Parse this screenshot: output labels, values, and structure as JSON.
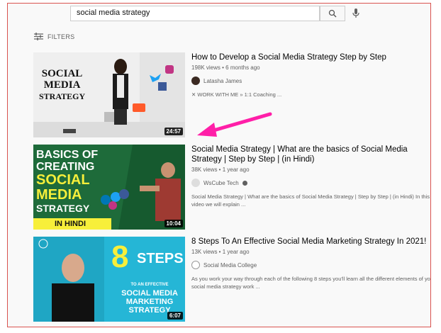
{
  "search": {
    "query": "social media strategy"
  },
  "filters_label": "FILTERS",
  "results": [
    {
      "thumb_lines": [
        "SOCIAL",
        "MEDIA",
        "STRATEGY"
      ],
      "duration": "24:57",
      "title": "How to Develop a Social Media Strategy Step by Step",
      "meta": "198K views • 6 months ago",
      "channel": "Latasha James",
      "desc": "✕ WORK WITH ME » 1:1 Coaching ..."
    },
    {
      "thumb_lines": [
        "BASICS OF",
        "CREATING",
        "SOCIAL",
        "MEDIA",
        "STRATEGY",
        "IN HINDI"
      ],
      "duration": "10:04",
      "title": "Social Media Strategy | What are the basics of Social Media Strategy | Step by Step | (in Hindi)",
      "meta": "38K views • 1 year ago",
      "channel": "WsCube Tech",
      "desc": "Social Media Strategy | What are the basics of Social Media Strategy | Step by Step | (in Hindi) In this video we will explain ..."
    },
    {
      "thumb_lines": [
        "8",
        "STEPS",
        "TO AN EFFECTIVE",
        "SOCIAL MEDIA",
        "MARKETING",
        "STRATEGY"
      ],
      "duration": "6:07",
      "title": "8 Steps To An Effective Social Media Marketing Strategy In 2021!",
      "meta": "13K views • 1 year ago",
      "channel": "Social Media College",
      "desc": "As you work your way through each of the following 8 steps you'll learn all the different elements of your social media strategy work ..."
    }
  ],
  "colors": {
    "arrow": "#ff1fa8",
    "thumb2_bg": "#1e6b3a",
    "thumb3_bg": "#25b6d6",
    "accent_yellow": "#f7ef3a"
  }
}
